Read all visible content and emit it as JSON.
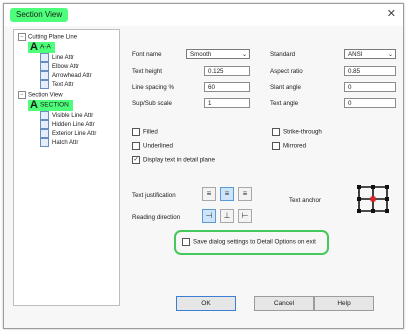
{
  "window": {
    "title": "Section View"
  },
  "tree": [
    {
      "label": "Cutting Plane Line",
      "level": 0,
      "toggle": "−"
    },
    {
      "label": "A-A",
      "level": 1,
      "big": true
    },
    {
      "label": "Line Attr",
      "level": 2
    },
    {
      "label": "Elbow Attr",
      "level": 2
    },
    {
      "label": "Arrowhead Attr",
      "level": 2
    },
    {
      "label": "Text Attr",
      "level": 2
    },
    {
      "label": "Section View",
      "level": 0,
      "toggle": "−"
    },
    {
      "label": "SECTION",
      "level": 1,
      "big": true
    },
    {
      "label": "Visible Line Attr",
      "level": 2
    },
    {
      "label": "Hidden Line Attr",
      "level": 2
    },
    {
      "label": "Exterior Line Attr",
      "level": 2
    },
    {
      "label": "Hatch Attr",
      "level": 2
    }
  ],
  "form": {
    "font_name_label": "Font name",
    "font_name_value": "Smooth",
    "standard_label": "Standard",
    "standard_value": "ANSI",
    "text_height_label": "Text height",
    "text_height_value": "0.125",
    "aspect_ratio_label": "Aspect ratio",
    "aspect_ratio_value": "0.85",
    "line_spacing_label": "Line spacing %",
    "line_spacing_value": "60",
    "slant_angle_label": "Slant angle",
    "slant_angle_value": "0",
    "sup_sub_label": "Sup/Sub scale",
    "sup_sub_value": "1",
    "text_angle_label": "Text angle",
    "text_angle_value": "0"
  },
  "checkboxes": {
    "filled": {
      "label": "Filled",
      "checked": false
    },
    "strike": {
      "label": "Strike-through",
      "checked": false
    },
    "underlined": {
      "label": "Underlined",
      "checked": false
    },
    "mirrored": {
      "label": "Mirrored",
      "checked": false
    },
    "display_plane": {
      "label": "Display text in detail plane",
      "checked": true
    },
    "save_defaults": {
      "label": "Save dialog settings to Detail Options on exit",
      "checked": false
    }
  },
  "labels": {
    "justification": "Text justification",
    "reading_direction": "Reading direction",
    "text_anchor": "Text anchor"
  },
  "buttons": {
    "ok": "OK",
    "cancel": "Cancel",
    "help": "Help"
  },
  "colors": {
    "highlight": "#4dff7a",
    "outline": "#45c85c",
    "anchor_point": "#e02020"
  }
}
